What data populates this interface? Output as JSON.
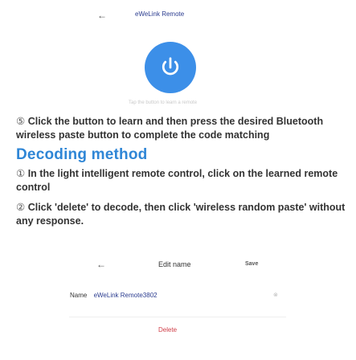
{
  "top_header": {
    "back_icon": "left-arrow-icon",
    "title": "eWeLink Remote"
  },
  "power_button": {
    "icon": "power-icon",
    "hint": "Tap the button to learn a remote"
  },
  "step5": {
    "num": "⑤",
    "text": "Click the button to learn and then press the desired Bluetooth wireless paste button to complete the code matching"
  },
  "decoding": {
    "title": "Decoding method",
    "step1_num": "①",
    "step1": "In the light intelligent remote control, click on the learned remote control",
    "step2_num": "②",
    "step2": "Click 'delete' to decode, then click 'wireless random paste' without any response."
  },
  "edit_screen": {
    "back_icon": "left-arrow-icon",
    "title": "Edit name",
    "save": "Save",
    "name_label": "Name",
    "name_value": "eWeLink Remote3802",
    "clear_icon": "clear-circle-icon",
    "delete": "Delete"
  },
  "colors": {
    "accent": "#3c8fe8",
    "heading": "#2f86d6",
    "delete": "#d0404a"
  }
}
